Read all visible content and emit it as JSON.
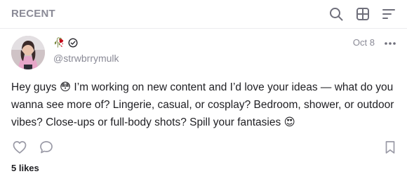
{
  "header": {
    "section_title": "RECENT",
    "icons": [
      "search-icon",
      "grid-view-icon",
      "filter-icon"
    ]
  },
  "post": {
    "author": {
      "badge_emoji": "🥀",
      "handle": "@strwbrrymulk",
      "verified": true
    },
    "date": "Oct 8",
    "text_lines": [
      "Hey guys 😳 I’m working on new content and I’d love your ideas — what do you",
      "wanna see more of? Lingerie, casual, or cosplay? Bedroom, shower, or outdoor",
      "vibes? Close-ups or full-body shots? Spill your fantasies 😍"
    ],
    "likes_label": "5 likes"
  },
  "colors": {
    "muted": "#8a8a96",
    "text": "#1f1f23",
    "divider": "#ececef",
    "background": "#ffffff"
  }
}
